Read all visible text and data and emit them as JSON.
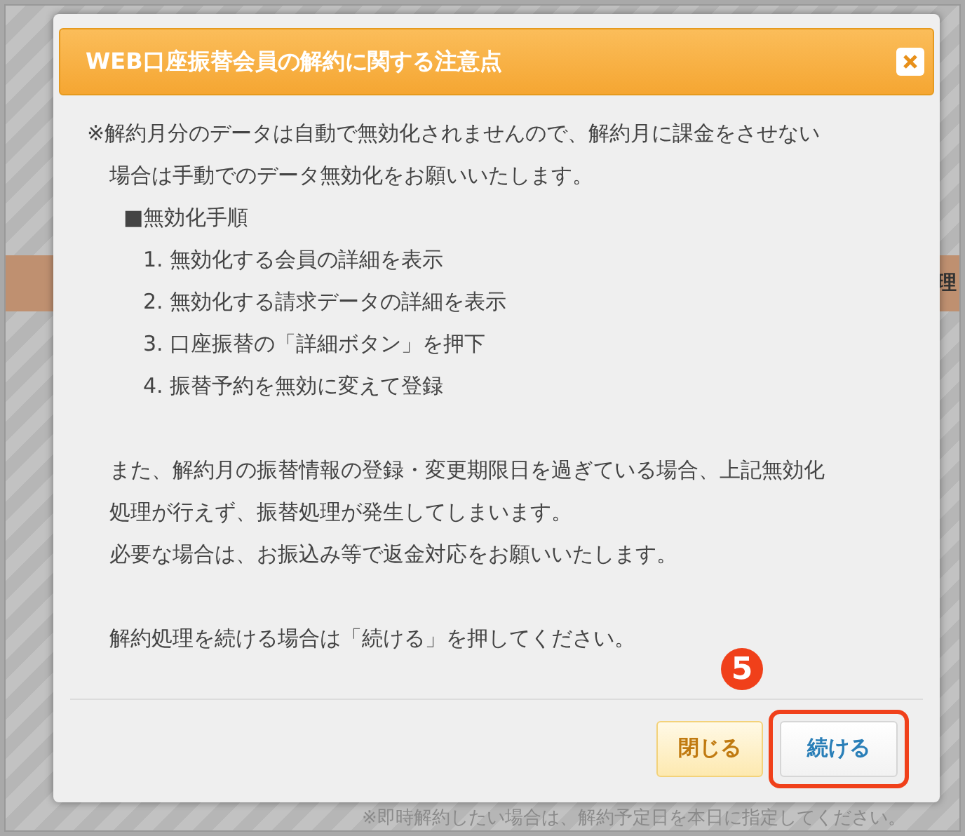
{
  "background": {
    "header_fragment": "理",
    "note": "※即時解約したい場合は、解約予定日を本日に指定してください。"
  },
  "dialog": {
    "title": "WEB口座振替会員の解約に関する注意点",
    "lines": [
      {
        "kind": "line",
        "text": "※解約月分のデータは自動で無効化されませんので、解約月に課金をさせない"
      },
      {
        "kind": "indent",
        "text": "場合は手動でのデータ無効化をお願いいたします。"
      },
      {
        "kind": "heading",
        "text": "■無効化手順"
      },
      {
        "kind": "step",
        "text": "1. 無効化する会員の詳細を表示"
      },
      {
        "kind": "step",
        "text": "2. 無効化する請求データの詳細を表示"
      },
      {
        "kind": "step",
        "text": "3. 口座振替の「詳細ボタン」を押下"
      },
      {
        "kind": "step",
        "text": "4. 振替予約を無効に変えて登録"
      },
      {
        "kind": "gap"
      },
      {
        "kind": "indent",
        "text": "また、解約月の振替情報の登録・変更期限日を過ぎている場合、上記無効化"
      },
      {
        "kind": "indent",
        "text": "処理が行えず、振替処理が発生してしまいます。"
      },
      {
        "kind": "indent",
        "text": "必要な場合は、お振込み等で返金対応をお願いいたします。"
      },
      {
        "kind": "gap"
      },
      {
        "kind": "indent",
        "text": "解約処理を続ける場合は「続ける」を押してください。"
      }
    ],
    "buttons": [
      {
        "label": "閉じる",
        "kind": "secondary",
        "highlighted": false
      },
      {
        "label": "続ける",
        "kind": "primary",
        "highlighted": true
      }
    ]
  },
  "annotation": {
    "number": "5"
  }
}
